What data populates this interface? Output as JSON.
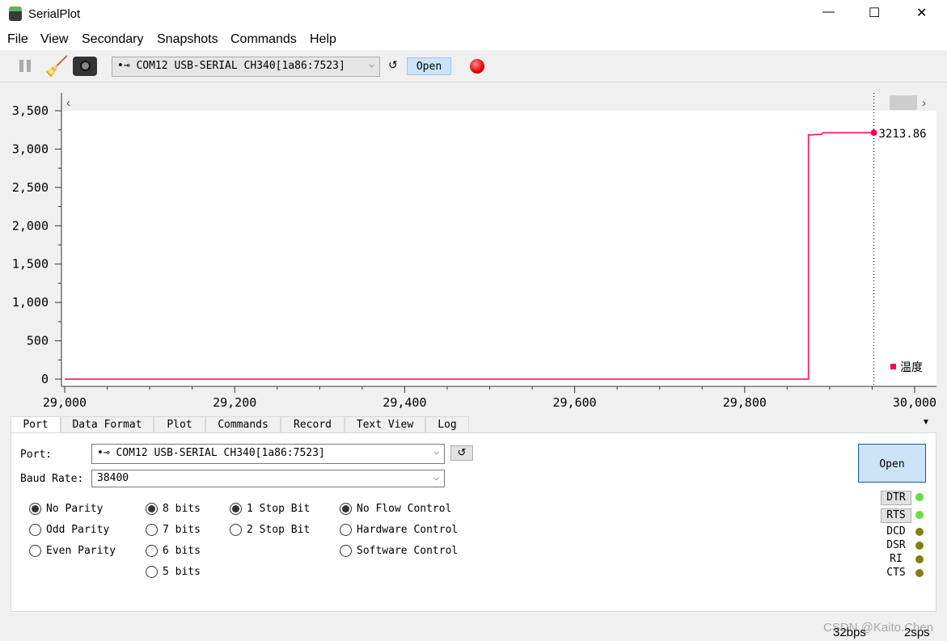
{
  "window": {
    "title": "SerialPlot",
    "minimize": "—",
    "maximize": "☐",
    "close": "✕"
  },
  "menu": [
    "File",
    "View",
    "Secondary",
    "Snapshots",
    "Commands",
    "Help"
  ],
  "toolbar": {
    "port": "COM12 USB-SERIAL CH340[1a86:7523]",
    "refresh": "↺",
    "open": "Open"
  },
  "chart_data": {
    "type": "line",
    "xlim": [
      29000,
      30000
    ],
    "ylim": [
      0,
      3500
    ],
    "xticks": [
      "29,000",
      "29,200",
      "29,400",
      "29,600",
      "29,800",
      "30,000"
    ],
    "yticks": [
      "0",
      "500",
      "1,000",
      "1,500",
      "2,000",
      "2,500",
      "3,000",
      "3,500"
    ],
    "series": [
      {
        "name": "温度",
        "color": "#ff0055",
        "x": [
          29000,
          29875,
          29875,
          29880,
          29882,
          29890,
          29892,
          29952
        ],
        "y": [
          0,
          0,
          3185,
          3185,
          3190,
          3190,
          3213,
          3213.86
        ]
      }
    ],
    "cursor": {
      "x": 29952,
      "label": "3213.86"
    },
    "legend": "bottom-right",
    "grid": false
  },
  "tabs": [
    "Port",
    "Data Format",
    "Plot",
    "Commands",
    "Record",
    "Text View",
    "Log"
  ],
  "port_panel": {
    "port_label": "Port:",
    "port_value": "COM12 USB-SERIAL CH340[1a86:7523]",
    "refresh": "↺",
    "baud_label": "Baud Rate:",
    "baud_value": "38400",
    "open": "Open",
    "parity": [
      {
        "label": "No Parity",
        "on": true
      },
      {
        "label": "Odd Parity"
      },
      {
        "label": "Even Parity"
      }
    ],
    "bits": [
      {
        "label": "8 bits",
        "on": true
      },
      {
        "label": "7 bits"
      },
      {
        "label": "6 bits"
      },
      {
        "label": "5 bits"
      }
    ],
    "stop": [
      {
        "label": "1 Stop Bit",
        "on": true
      },
      {
        "label": "2 Stop Bit"
      }
    ],
    "flow": [
      {
        "label": "No Flow Control",
        "on": true
      },
      {
        "label": "Hardware Control"
      },
      {
        "label": "Software Control"
      }
    ],
    "signals": {
      "dtr": "DTR",
      "rts": "RTS",
      "dcd": "DCD",
      "dsr": "DSR",
      "ri": "RI",
      "cts": "CTS"
    }
  },
  "status": {
    "bps": "32bps",
    "sps": "2sps",
    "watermark": "CSDN @Kaito.Chen"
  }
}
